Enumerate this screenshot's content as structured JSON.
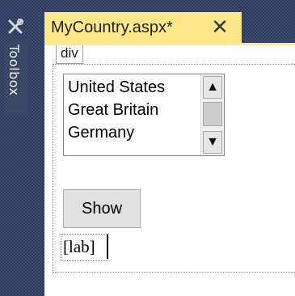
{
  "toolbox": {
    "icon": "toolbox-icon",
    "label": "Toolbox"
  },
  "document_tab": {
    "title": "MyCountry.aspx*",
    "close_glyph": "✕"
  },
  "designer": {
    "div_tag": "div",
    "listbox": {
      "items": [
        "United States",
        "Great Britain",
        "Germany"
      ],
      "scroll_up_glyph": "▲",
      "scroll_down_glyph": "▼"
    },
    "show_button_label": "Show",
    "label_text": "[lab]"
  },
  "colors": {
    "background_dark": "#2c3a5c",
    "tab_active": "#ffe88a",
    "designer_bg": "#ffffff"
  }
}
